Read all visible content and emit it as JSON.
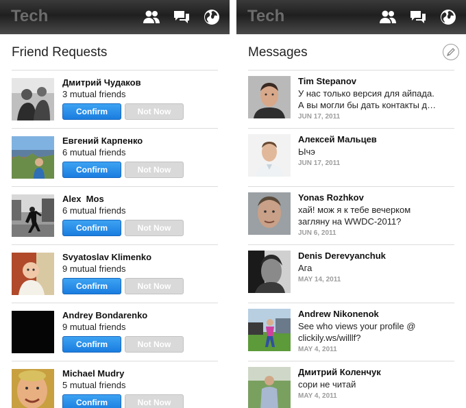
{
  "app": {
    "name": "Tech"
  },
  "nav_icons": [
    "friends-icon",
    "messages-icon",
    "globe-icon"
  ],
  "colors": {
    "confirm": "#1a7de0",
    "not_now": "#d9d9d9",
    "date": "#9c9c9c"
  },
  "friend_requests": {
    "title": "Friend Requests",
    "confirm_label": "Confirm",
    "not_now_label": "Not Now",
    "items": [
      {
        "name": "Дмитрий Чудаков",
        "mutual": "3 mutual friends"
      },
      {
        "name": "Евгений Карпенко",
        "mutual": "6 mutual friends"
      },
      {
        "name": "Alex  Mos",
        "mutual": "6 mutual friends"
      },
      {
        "name": "Svyatoslav Klimenko",
        "mutual": "9 mutual friends"
      },
      {
        "name": "Andrey Bondarenko",
        "mutual": "9 mutual friends"
      },
      {
        "name": "Michael Mudry",
        "mutual": "5 mutual friends"
      }
    ]
  },
  "messages": {
    "title": "Messages",
    "items": [
      {
        "name": "Tim Stepanov",
        "text": "У нас только версия для айпада.\nА вы могли бы дать контакты д…",
        "date": "JUN 17, 2011"
      },
      {
        "name": "Алексей Мальцев",
        "text": "Ычэ",
        "date": "JUN 17, 2011"
      },
      {
        "name": "Yonas Rozhkov",
        "text": "хай! мож я к тебе вечерком\nзагляну на WWDC-2011?",
        "date": "JUN 6, 2011"
      },
      {
        "name": "Denis Derevyanchuk",
        "text": "Ага",
        "date": "MAY 14, 2011"
      },
      {
        "name": "Andrew Nikonenok",
        "text": "See who views your profile @\nclickily.ws/willlf?",
        "date": "MAY 4, 2011"
      },
      {
        "name": "Дмитрий Коленчук",
        "text": "сори не читай",
        "date": "MAY 4, 2011"
      }
    ]
  }
}
